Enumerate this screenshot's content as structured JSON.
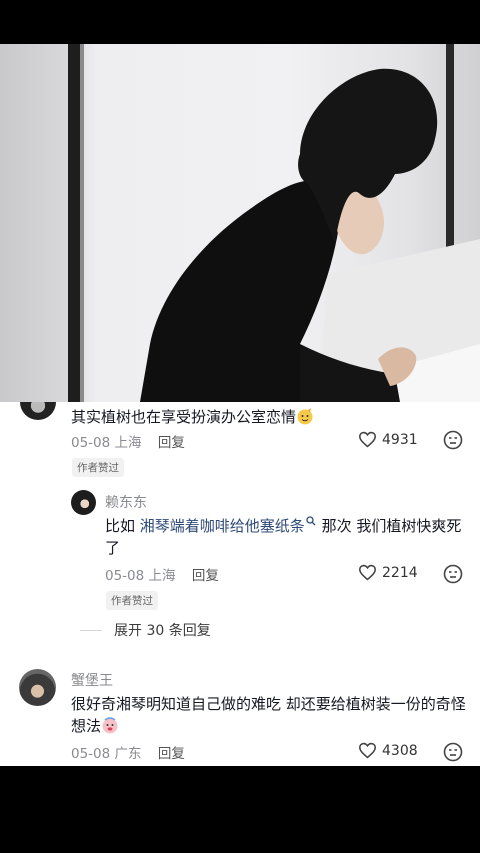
{
  "comment1": {
    "text": "其实植树也在享受扮演办公室恋情",
    "date": "05-08",
    "location": "上海",
    "reply_label": "回复",
    "likes": "4931",
    "badge": "作者赞过"
  },
  "reply1": {
    "username": "赖东东",
    "text_prefix": "比如 ",
    "text_highlight": "湘琴端着咖啡给他塞纸条",
    "text_suffix": " 那次 我们植树快爽死了",
    "date": "05-08",
    "location": "上海",
    "reply_label": "回复",
    "likes": "2214",
    "badge": "作者赞过"
  },
  "expand_label": "展开 30 条回复",
  "comment2": {
    "username": "蟹堡王",
    "text": "很好奇湘琴明知道自己做的难吃 却还要给植树装一份的奇怪想法",
    "date": "05-08",
    "location": "广东",
    "reply_label": "回复",
    "likes": "4308"
  }
}
